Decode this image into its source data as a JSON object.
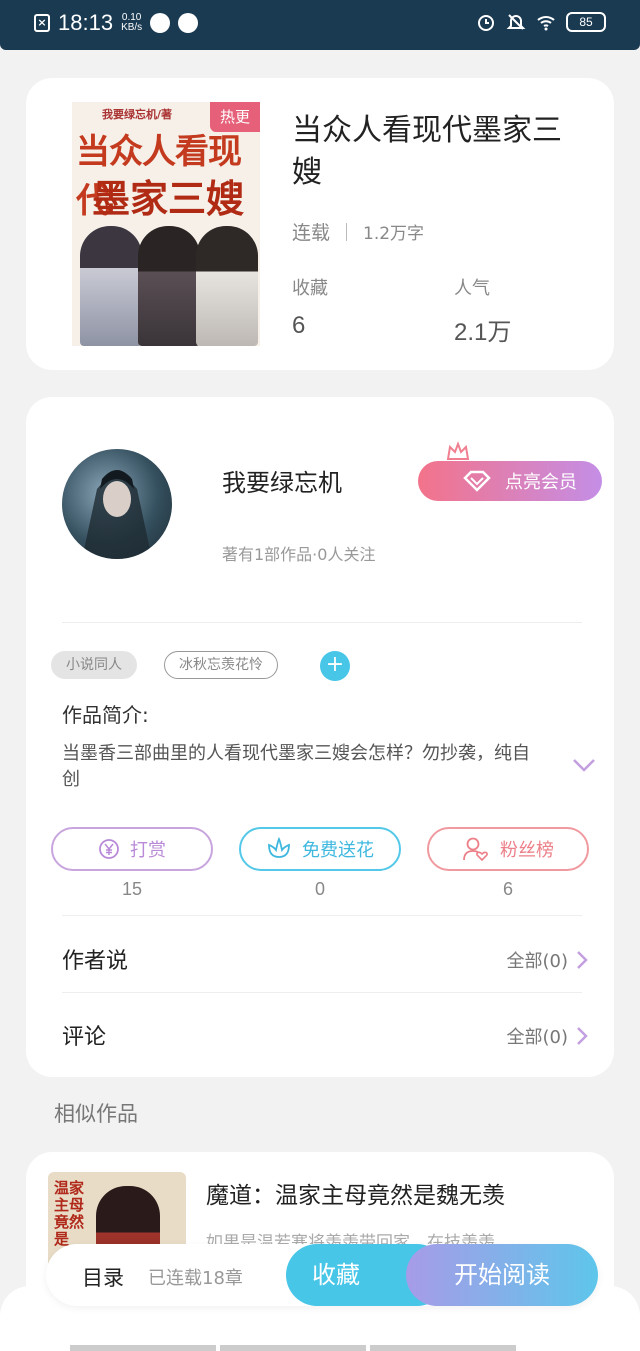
{
  "status_bar": {
    "time": "18:13",
    "speed_value": "0.10",
    "speed_unit": "KB/s",
    "battery": "85"
  },
  "book": {
    "title": "当众人看现代墨家三嫂",
    "hot_tag": "热更",
    "cover_title_line1": "当众人看现代",
    "cover_title_line2": "墨家三嫂",
    "cover_author": "我要绿忘机/著",
    "status": "连载",
    "word_count": "1.2万字",
    "favorites_label": "收藏",
    "favorites_value": "6",
    "popularity_label": "人气",
    "popularity_value": "2.1万"
  },
  "author": {
    "name": "我要绿忘机",
    "vip_button": "点亮会员",
    "works_info": "著有1部作品·0人关注"
  },
  "tags": [
    "小说同人",
    "冰秋忘羡花怜"
  ],
  "intro": {
    "label": "作品简介:",
    "text": "当墨香三部曲里的人看现代墨家三嫂会怎样？勿抄袭，纯自创"
  },
  "actions": [
    {
      "label": "打赏",
      "count": "15",
      "icon": "yen-coin-icon"
    },
    {
      "label": "免费送花",
      "count": "0",
      "icon": "flower-icon"
    },
    {
      "label": "粉丝榜",
      "count": "6",
      "icon": "fan-heart-icon"
    }
  ],
  "author_says": {
    "label": "作者说",
    "link": "全部(0)"
  },
  "comments": {
    "label": "评论",
    "link": "全部(0)"
  },
  "similar": {
    "section_title": "相似作品",
    "items": [
      {
        "title": "魔道：温家主母竟然是魏无羡",
        "desc": "如果是温若寒将羡羡带回家，在技羡羡…",
        "cover_text": "温家主母竟然是"
      }
    ]
  },
  "bottom_bar": {
    "toc_label": "目录",
    "chapters": "已连载18章",
    "favorite_button": "收藏",
    "read_button": "开始阅读"
  },
  "colors": {
    "accent_blue": "#47c6e8",
    "accent_purple": "#b98ad8",
    "accent_pink": "#ec7f88",
    "hot_tag": "#e6607a"
  }
}
